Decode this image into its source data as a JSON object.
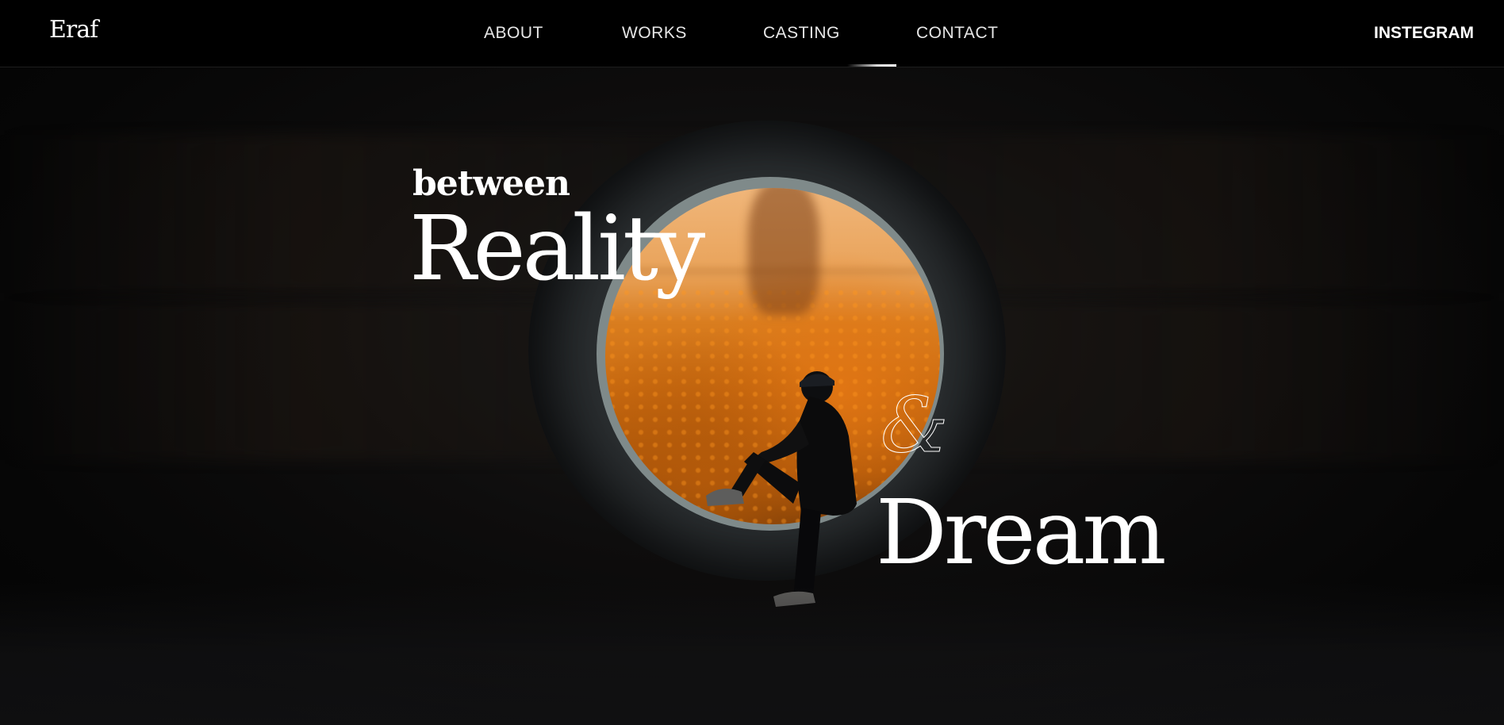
{
  "header": {
    "logo": "Eraf",
    "nav": [
      {
        "label": "ABOUT"
      },
      {
        "label": "WORKS"
      },
      {
        "label": "CASTING"
      },
      {
        "label": "CONTACT"
      }
    ],
    "instagram": "INSTEGRAM"
  },
  "hero": {
    "word_between": "between",
    "word_reality": "Reality",
    "word_amp": "&",
    "word_dream": "Dream"
  }
}
